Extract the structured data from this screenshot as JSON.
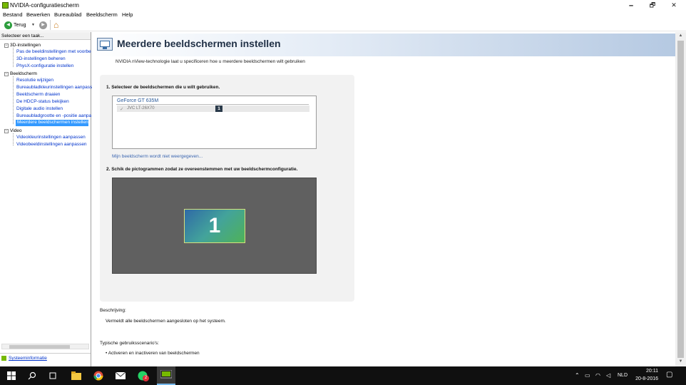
{
  "window": {
    "title": "NVIDIA-configuratiescherm",
    "minimize": "🗕",
    "maximize": "🗗",
    "close": "✕"
  },
  "menu": [
    "Bestand",
    "Bewerken",
    "Bureaublad",
    "Beeldscherm",
    "Help"
  ],
  "toolbar": {
    "back_label": "Terug",
    "back_arrow": "◀",
    "forward_arrow": "▶",
    "dropdown_arrow": "▼",
    "home_icon": "⌂"
  },
  "sidebar": {
    "task_header": "Selecteer een taak...",
    "categories": [
      {
        "label": "3D-instellingen",
        "items": [
          "Pas de beeldinstellingen met voorbe",
          "3D-instellingen beheren",
          "PhysX-configuratie instellen"
        ]
      },
      {
        "label": "Beeldscherm",
        "items": [
          "Resolutie wijzigen",
          "Bureaubladkleurinstellingen aanpass",
          "Beeldscherm draaien",
          "De HDCP-status bekijken",
          "Digitale audio instellen",
          "Bureaubladgrootte en -positie aanpa",
          "Meerdere beeldschermen instellen"
        ]
      },
      {
        "label": "Video",
        "items": [
          "Videokleurinstellingen aanpassen",
          "Videobeeldinstellingen aanpassen"
        ]
      }
    ],
    "selected_item": "Meerdere beeldschermen instellen",
    "system_info": "Systeeminformatie"
  },
  "main": {
    "title": "Meerdere beeldschermen instellen",
    "subtitle": "NVIDIA nView-technologie laat u specificeren hoe u meerdere beeldschermen wilt gebruiken",
    "step1": "1. Selecteer de beeldschermen die u wilt gebruiken.",
    "gpu": "GeForce GT 635M",
    "display_check": "✓",
    "display_name": "JVC LT-26X70",
    "display_number": "1",
    "missing_link": "Mijn beeldscherm wordt niet weergegeven...",
    "step2": "2. Schik de pictogrammen zodat ze overeenstemmen met uw beeldschermconfiguratie.",
    "monitor_label": "1",
    "description_label": "Beschrijving:",
    "description_text": "Vermeldt alle beeldschermen aangesloten op het systeem.",
    "usage_label": "Typische gebruiksscenario's:",
    "usage_item": "• Activeren en inactiveren van beeldschermen"
  },
  "taskbar": {
    "language": "NLD",
    "time": "20:11",
    "date": "20-8-2016",
    "badge": "2"
  },
  "colors": {
    "nvidia_green": "#76b900",
    "selection": "#3399ff",
    "link": "#0033cc"
  }
}
